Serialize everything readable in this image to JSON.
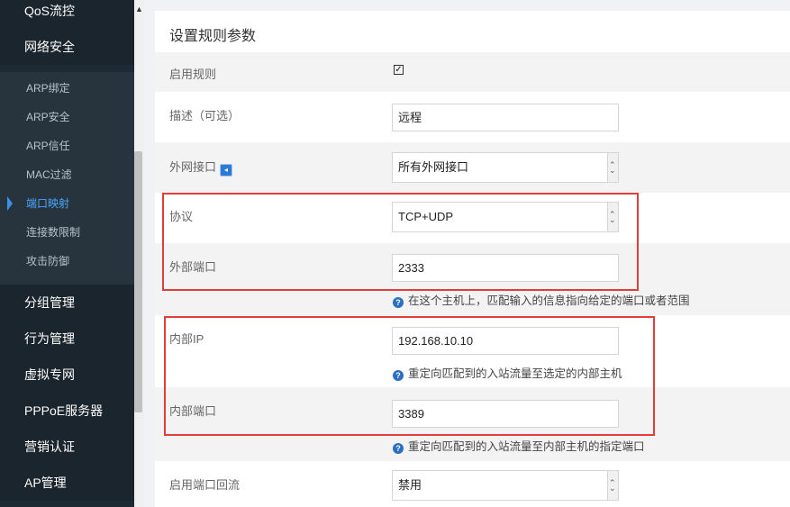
{
  "sidebar": {
    "top_items": [
      "QoS流控",
      "网络安全"
    ],
    "sub_items": [
      "ARP绑定",
      "ARP安全",
      "ARP信任",
      "MAC过滤",
      "端口映射",
      "连接数限制",
      "攻击防御"
    ],
    "active_sub": "端口映射",
    "bottom_items": [
      "分组管理",
      "行为管理",
      "虚拟专网",
      "PPPoE服务器",
      "营销认证",
      "AP管理"
    ]
  },
  "panel": {
    "title": "设置规则参数",
    "enable_rule_label": "启用规则",
    "enable_rule_checked": true,
    "description_label": "描述（可选）",
    "description_value": "远程",
    "wan_label": "外网接口",
    "wan_value": "所有外网接口",
    "protocol_label": "协议",
    "protocol_value": "TCP+UDP",
    "external_port_label": "外部端口",
    "external_port_value": "2333",
    "external_port_hint": "在这个主机上，匹配输入的信息指向给定的端口或者范围",
    "internal_ip_label": "内部IP",
    "internal_ip_value": "192.168.10.10",
    "internal_ip_hint": "重定向匹配到的入站流量至选定的内部主机",
    "internal_port_label": "内部端口",
    "internal_port_value": "3389",
    "internal_port_hint": "重定向匹配到的入站流量至内部主机的指定端口",
    "loopback_label": "启用端口回流",
    "loopback_value": "禁用"
  },
  "colors": {
    "highlight_box": "#e43b3b",
    "active_nav": "#4aa8ff",
    "sidebar_bg": "#1e2a33"
  }
}
